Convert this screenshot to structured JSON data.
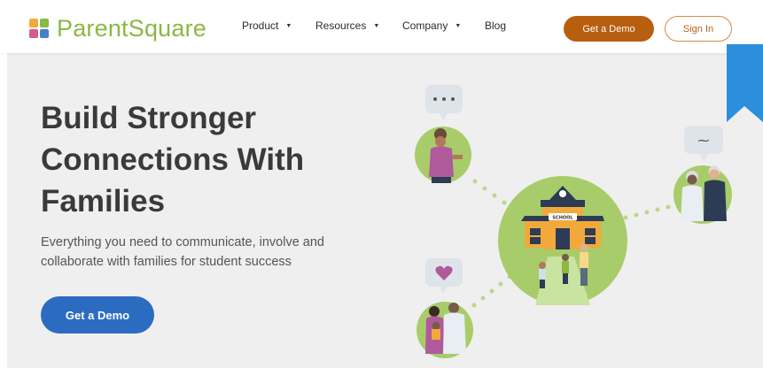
{
  "brand": {
    "name": "ParentSquare",
    "color": "#8cb844"
  },
  "nav": {
    "items": [
      {
        "label": "Product",
        "has_dropdown": true
      },
      {
        "label": "Resources",
        "has_dropdown": true
      },
      {
        "label": "Company",
        "has_dropdown": true
      },
      {
        "label": "Blog",
        "has_dropdown": false
      }
    ],
    "caret": "▼"
  },
  "header_actions": {
    "demo_label": "Get a Demo",
    "signin_label": "Sign In"
  },
  "hero": {
    "title_lines": [
      "Build Stronger",
      "Connections With",
      "Families"
    ],
    "subtitle_lines": [
      "Everything you need to communicate, involve and",
      "collaborate with families for student success"
    ],
    "cta_label": "Get a Demo"
  },
  "illustration": {
    "school_sign": "SCHOOL"
  },
  "colors": {
    "accent_orange": "#b85e0f",
    "accent_blue": "#2c6cc0",
    "hero_bg": "#efefef",
    "illustration_green": "#a8cc6a"
  }
}
